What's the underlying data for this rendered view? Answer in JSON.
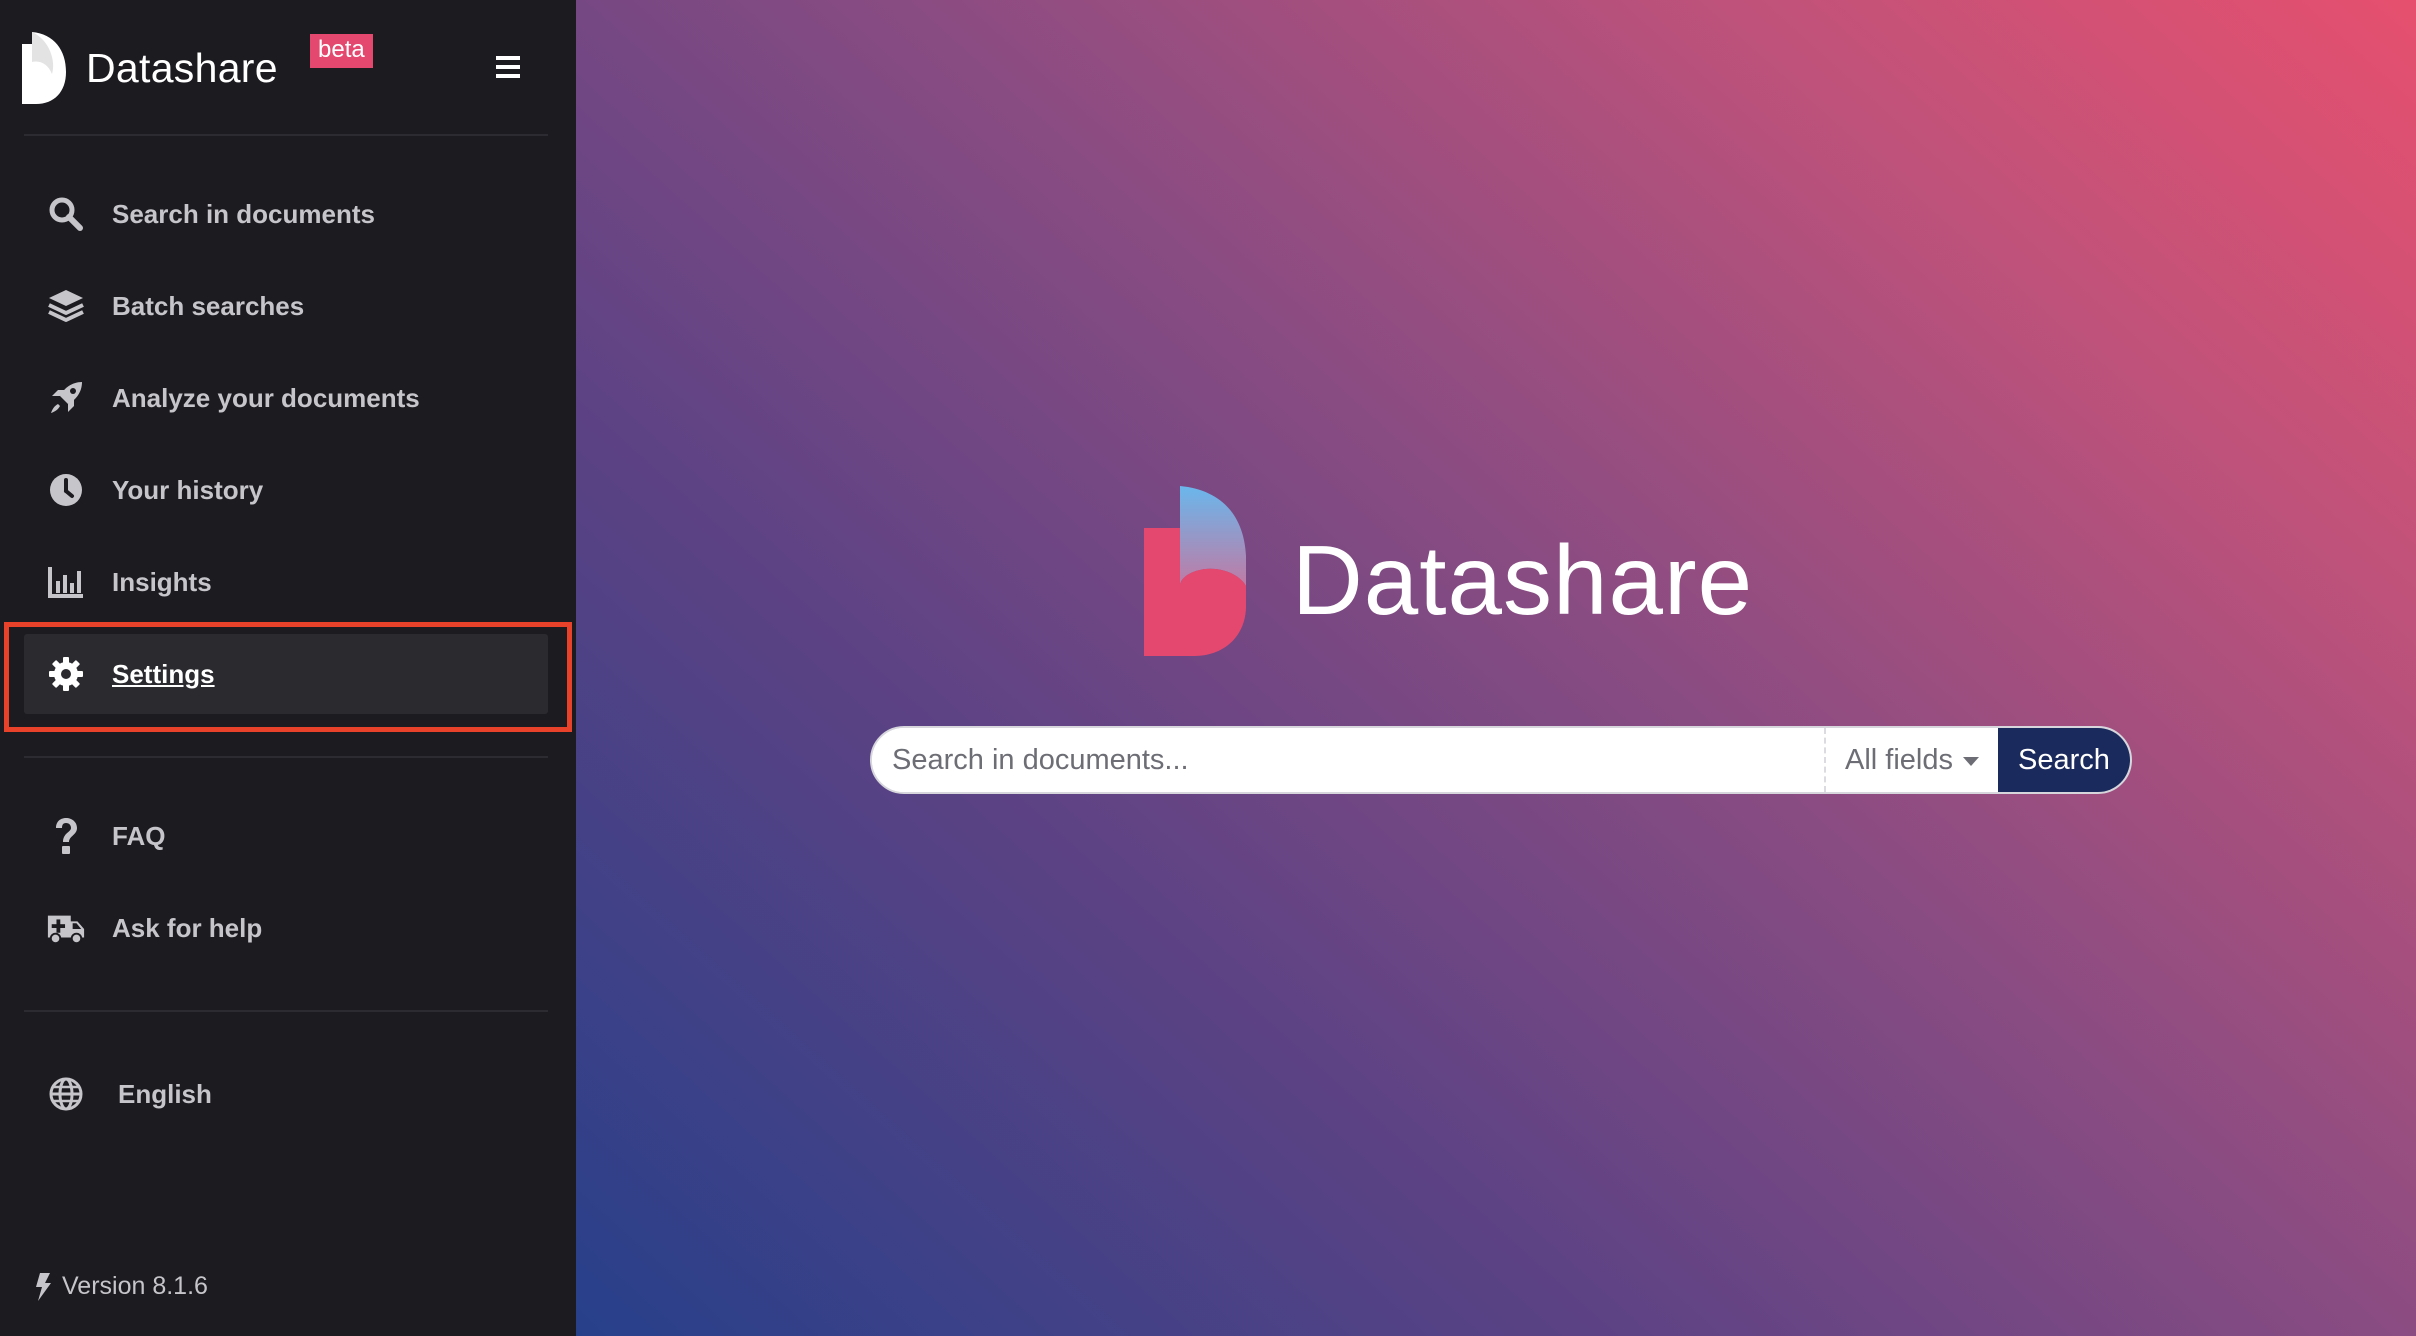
{
  "brand": {
    "name": "Datashare",
    "badge": "beta"
  },
  "sidebar": {
    "menu_icon": "hamburger-icon",
    "items": [
      {
        "label": "Search in documents",
        "icon": "search-icon"
      },
      {
        "label": "Batch searches",
        "icon": "layers-icon"
      },
      {
        "label": "Analyze your documents",
        "icon": "rocket-icon"
      },
      {
        "label": "Your history",
        "icon": "clock-icon"
      },
      {
        "label": "Insights",
        "icon": "bar-chart-icon"
      },
      {
        "label": "Settings",
        "icon": "gear-icon",
        "active": true
      }
    ],
    "help_items": [
      {
        "label": "FAQ",
        "icon": "question-icon"
      },
      {
        "label": "Ask for help",
        "icon": "ambulance-icon"
      }
    ],
    "language": {
      "label": "English",
      "icon": "globe-icon"
    },
    "version": "Version 8.1.6"
  },
  "main": {
    "title": "Datashare",
    "search": {
      "placeholder": "Search in documents...",
      "value": "",
      "field_selector": "All fields",
      "button_label": "Search"
    }
  },
  "colors": {
    "sidebar_bg": "#1b1b20",
    "accent_pink": "#e5486e",
    "search_button": "#1a2a5c",
    "highlight": "#e8422a"
  }
}
